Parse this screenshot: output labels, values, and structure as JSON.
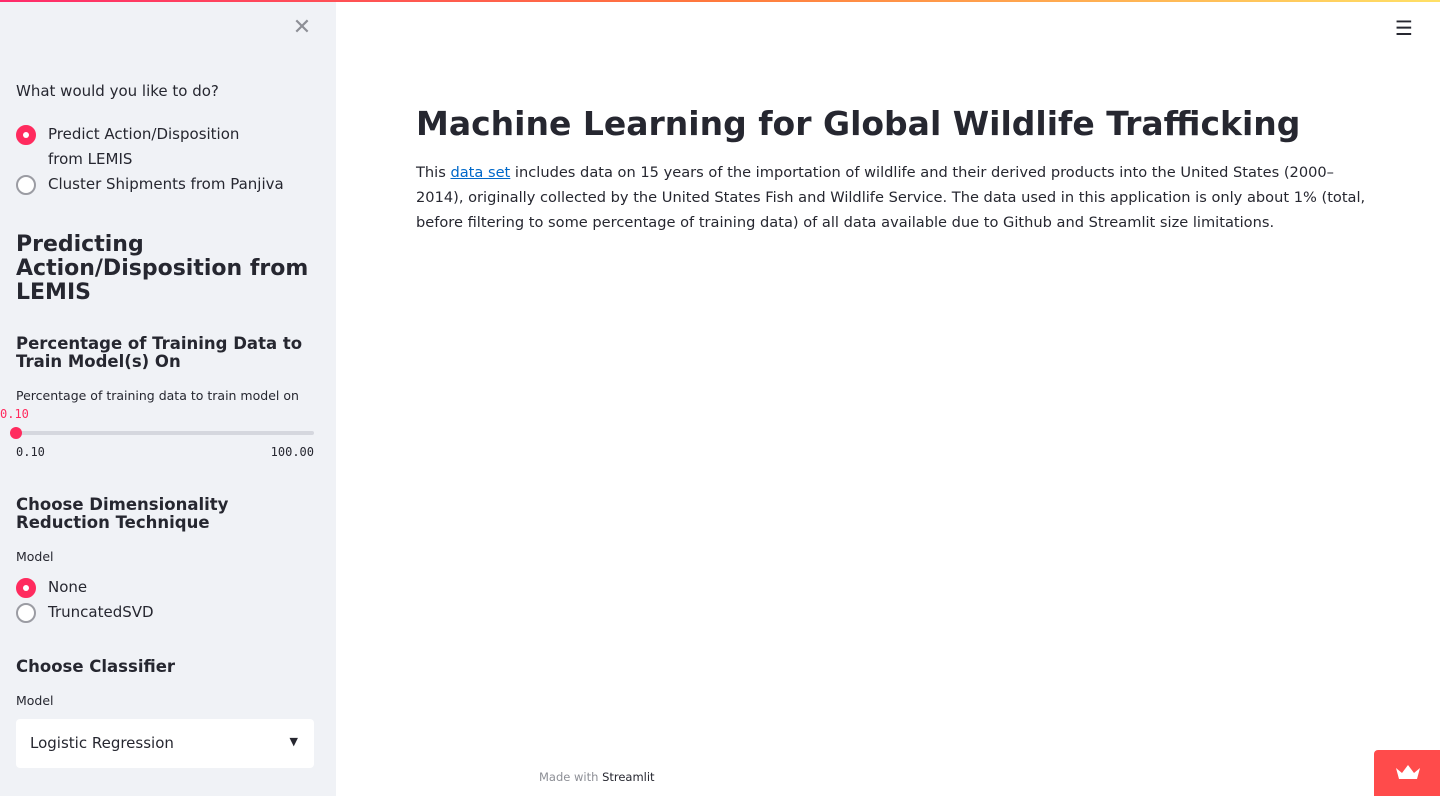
{
  "sidebar": {
    "question": "What would you like to do?",
    "modes": [
      {
        "label": "Predict Action/Disposition from LEMIS",
        "checked": true
      },
      {
        "label": "Cluster Shipments from Panjiva",
        "checked": false
      }
    ],
    "section_title": "Predicting Action/Disposition from LEMIS",
    "training": {
      "heading": "Percentage of Training Data to Train Model(s) On",
      "slider_label": "Percentage of training data to train model on",
      "value": "0.10",
      "min": "0.10",
      "max": "100.00"
    },
    "dim_reduction": {
      "heading": "Choose Dimensionality Reduction Technique",
      "label": "Model",
      "options": [
        {
          "label": "None",
          "checked": true
        },
        {
          "label": "TruncatedSVD",
          "checked": false
        }
      ]
    },
    "classifier": {
      "heading": "Choose Classifier",
      "label": "Model",
      "selected": "Logistic Regression"
    }
  },
  "main": {
    "title": "Machine Learning for Global Wildlife Trafficking",
    "intro_before": "This ",
    "intro_link": "data set",
    "intro_after": " includes data on 15 years of the importation of wildlife and their derived products into the United States (2000–2014), originally collected by the United States Fish and Wildlife Service. The data used in this application is only about 1% (total, before filtering to some percentage of training data) of all data available due to Github and Streamlit size limitations."
  },
  "footer": {
    "made_with": "Made with ",
    "brand": "Streamlit"
  },
  "colors": {
    "accent": "#ff2b5e",
    "link": "#0068c9",
    "sidebar_bg": "#f0f2f6",
    "badge": "#ff4b4b"
  }
}
